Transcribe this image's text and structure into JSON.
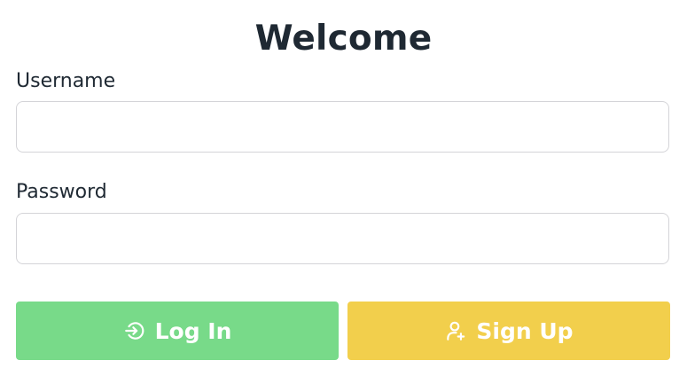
{
  "header": {
    "title": "Welcome"
  },
  "form": {
    "username": {
      "label": "Username",
      "value": "",
      "placeholder": ""
    },
    "password": {
      "label": "Password",
      "value": "",
      "placeholder": ""
    }
  },
  "actions": {
    "login": {
      "label": "Log In",
      "icon": "login-icon",
      "color": "#78da89"
    },
    "signup": {
      "label": "Sign Up",
      "icon": "user-plus-icon",
      "color": "#f2cf4c"
    }
  }
}
